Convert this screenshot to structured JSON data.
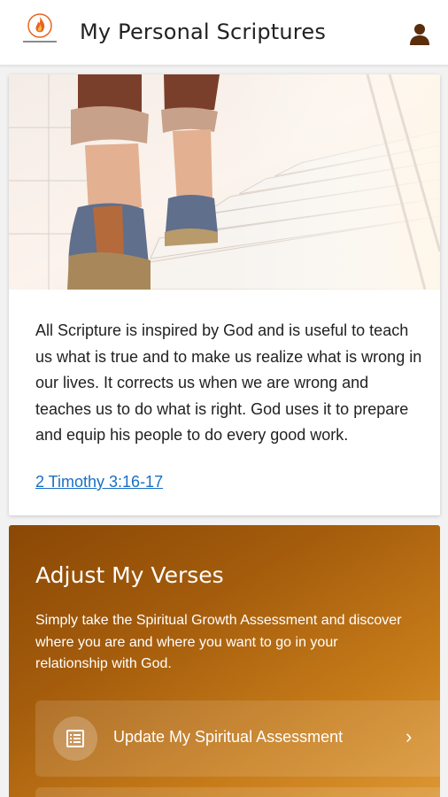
{
  "header": {
    "title": "My Personal Scriptures",
    "logo_icon": "flame-logo-icon",
    "profile_icon": "person-icon",
    "brand_color": "#e8641f"
  },
  "scripture": {
    "verse_text": "All Scripture is inspired by God and is useful to teach us what is true and to make us realize what is wrong in our lives. It corrects us when we are wrong and teaches us to do what is right. God uses it to prepare and equip his people to do every good work.",
    "reference": "2 Timothy 3:16-17",
    "link_color": "#1a6fc4"
  },
  "adjust": {
    "title": "Adjust My Verses",
    "description": "Simply take the Spiritual Growth Assessment and discover where you are and where you want to go in your relationship with God.",
    "assessment_button": {
      "label": "Update My Spiritual Assessment",
      "icon": "list-document-icon",
      "chevron": "›"
    },
    "gradient_colors": [
      "#8a4806",
      "#dd9834"
    ]
  }
}
